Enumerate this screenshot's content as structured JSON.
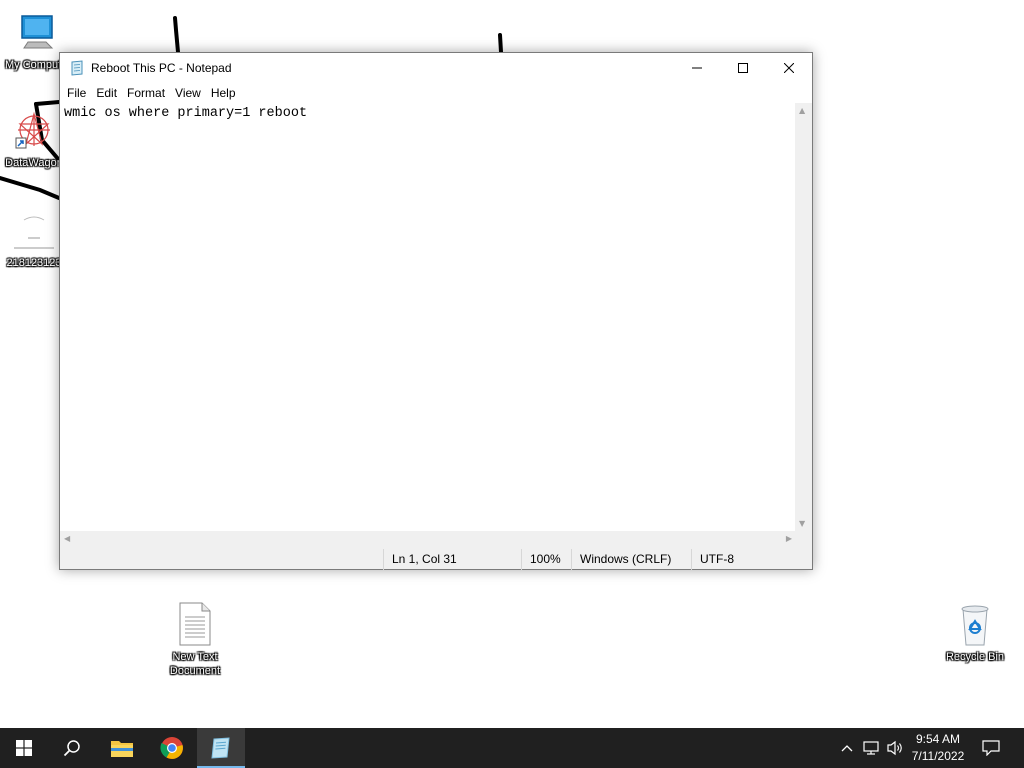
{
  "desktop": {
    "icons": [
      {
        "label": "My Computer",
        "icon": "monitor-icon"
      },
      {
        "label": "DataWagon",
        "icon": "datawagon-icon"
      },
      {
        "label": "218123123",
        "icon": "image-file-icon"
      },
      {
        "label": "New Text\nDocument",
        "icon": "text-file-icon"
      },
      {
        "label": "Recycle Bin",
        "icon": "recycle-bin-icon"
      }
    ]
  },
  "notepad": {
    "title": "Reboot This PC - Notepad",
    "menu": [
      "File",
      "Edit",
      "Format",
      "View",
      "Help"
    ],
    "content": "wmic os where primary=1 reboot",
    "status": {
      "position": "Ln 1, Col 31",
      "zoom": "100%",
      "line_ending": "Windows (CRLF)",
      "encoding": "UTF-8"
    }
  },
  "taskbar": {
    "apps": [
      "start-icon",
      "search-icon",
      "file-explorer-icon",
      "chrome-icon",
      "notepad-icon"
    ],
    "tray": [
      "chevron-up-icon",
      "network-icon",
      "volume-icon",
      "notification-icon"
    ],
    "time": "9:54 AM",
    "date": "7/11/2022"
  },
  "colors": {
    "taskbar": "#202020",
    "active_indicator": "#76b9ed",
    "desktop": "#ffffff"
  }
}
